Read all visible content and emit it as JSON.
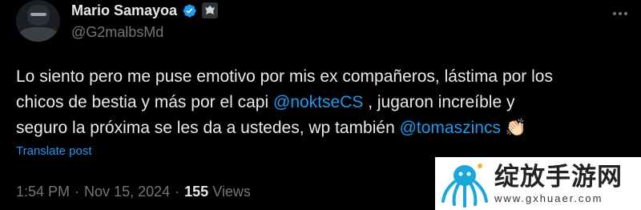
{
  "author": {
    "display_name": "Mario Samayoa",
    "handle": "@G2malbsMd"
  },
  "tweet": {
    "line1": "Lo siento pero me puse emotivo por mis ex compañeros, lástima por los",
    "line2_a": "chicos de bestia y más por el capi ",
    "mention1": "@noktseCS",
    "line2_b": " , jugaron increíble y",
    "line3_a": "seguro la próxima se les da a ustedes, wp también ",
    "mention2": "@tomaszincs",
    "emoji": "👏🏻"
  },
  "translate_label": "Translate post",
  "meta": {
    "time": "1:54 PM",
    "sep1": "·",
    "date": "Nov 15, 2024",
    "sep2": "·",
    "views_count": "155",
    "views_label": "Views"
  },
  "watermark": {
    "brand_cn": "绽放手游网",
    "url": "www.gxhuaer.com"
  },
  "colors": {
    "background": "#000000",
    "text": "#e7e9ea",
    "secondary": "#71767b",
    "link": "#1d9bf0"
  }
}
